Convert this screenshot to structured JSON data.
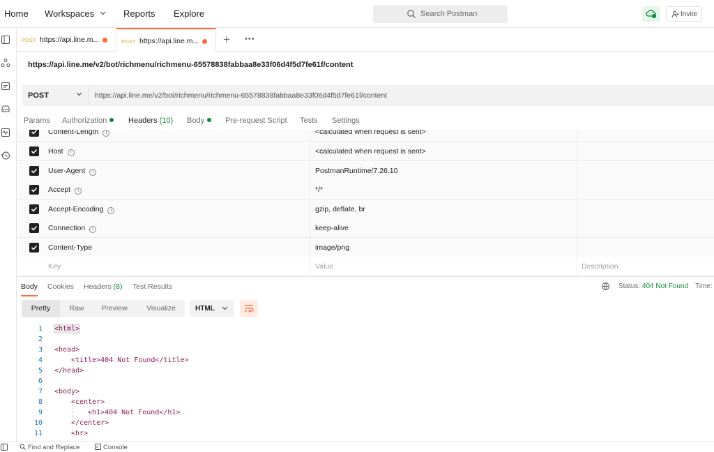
{
  "topbar": {
    "home": "Home",
    "workspaces": "Workspaces",
    "reports": "Reports",
    "explore": "Explore",
    "search_placeholder": "Search Postman",
    "invite": "Invite"
  },
  "tabs": [
    {
      "method": "POST",
      "label": "https://api.line.m..."
    },
    {
      "method": "POST",
      "label": "https://api.line.m..."
    }
  ],
  "request": {
    "title": "https://api.line.me/v2/bot/richmenu/richmenu-65578838fabbaa8e33f06d4f5d7fe61f/content",
    "method": "POST",
    "url": "https://api.line.me/v2/bot/richmenu/richmenu-65578838fabbaa8e33f06d4f5d7fe61f/content"
  },
  "subtabs": {
    "params": "Params",
    "authorization": "Authorization",
    "headers": "Headers",
    "headers_count": "(10)",
    "body": "Body",
    "prerequest": "Pre-request Script",
    "tests": "Tests",
    "settings": "Settings"
  },
  "headers": [
    {
      "key": "Content-Length",
      "value": "<calculated when request is sent>"
    },
    {
      "key": "Host",
      "value": "<calculated when request is sent>"
    },
    {
      "key": "User-Agent",
      "value": "PostmanRuntime/7.26.10"
    },
    {
      "key": "Accept",
      "value": "*/*"
    },
    {
      "key": "Accept-Encoding",
      "value": "gzip, deflate, br"
    },
    {
      "key": "Connection",
      "value": "keep-alive"
    },
    {
      "key": "Content-Type",
      "value": "image/png"
    }
  ],
  "headers_placeholder": {
    "key": "Key",
    "value": "Value",
    "description": "Description"
  },
  "response": {
    "tabs": {
      "body": "Body",
      "cookies": "Cookies",
      "headers": "Headers",
      "headers_count": "(8)",
      "test_results": "Test Results"
    },
    "status_label": "Status:",
    "status_value": "404 Not Found",
    "time_label": "Time:",
    "views": {
      "pretty": "Pretty",
      "raw": "Raw",
      "preview": "Preview",
      "visualize": "Visualize"
    },
    "format": "HTML"
  },
  "code_lines": [
    {
      "n": "1",
      "text": "<html>"
    },
    {
      "n": "2",
      "text": ""
    },
    {
      "n": "3",
      "text": "<head>"
    },
    {
      "n": "4",
      "text": "<title>404 Not Found</title>"
    },
    {
      "n": "5",
      "text": "</head>"
    },
    {
      "n": "6",
      "text": ""
    },
    {
      "n": "7",
      "text": "<body>"
    },
    {
      "n": "8",
      "text": "<center>"
    },
    {
      "n": "9",
      "text": "<h1>404 Not Found</h1>"
    },
    {
      "n": "10",
      "text": "</center>"
    },
    {
      "n": "11",
      "text": "<hr>"
    }
  ],
  "statusbar": {
    "find_replace": "Find and Replace",
    "console": "Console"
  },
  "colors": {
    "accent": "#ff6c37",
    "success": "#0f8a36",
    "method_post": "#e8a33d"
  }
}
